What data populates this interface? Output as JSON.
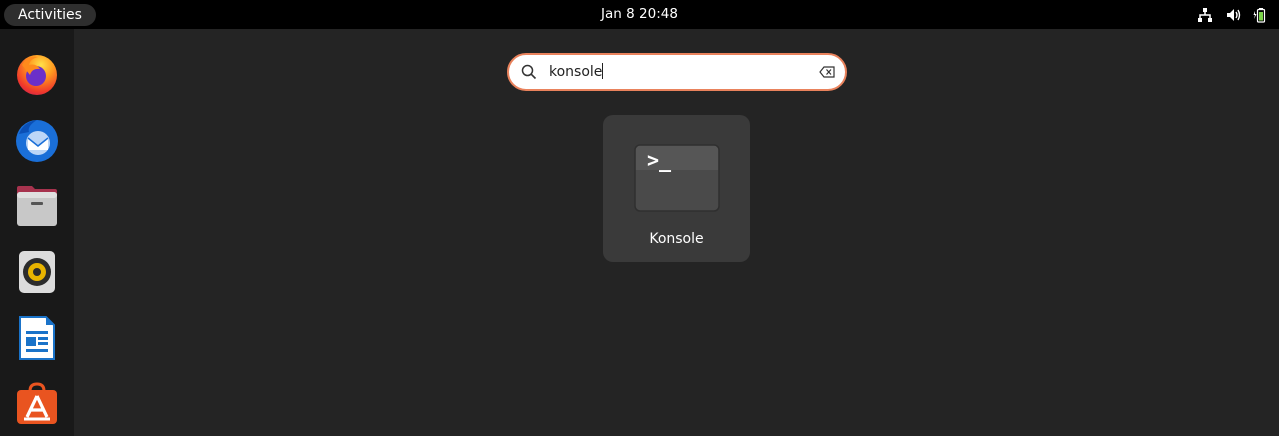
{
  "topbar": {
    "activities_label": "Activities",
    "clock": "Jan 8  20:48",
    "tray_icons": [
      "network-icon",
      "volume-icon",
      "battery-icon"
    ]
  },
  "dock": {
    "items": [
      {
        "name": "Firefox",
        "icon": "firefox-icon"
      },
      {
        "name": "Thunderbird",
        "icon": "thunderbird-icon"
      },
      {
        "name": "Files",
        "icon": "files-icon"
      },
      {
        "name": "Rhythmbox",
        "icon": "rhythmbox-icon"
      },
      {
        "name": "LibreOffice Writer",
        "icon": "libreoffice-writer-icon"
      },
      {
        "name": "Ubuntu Software",
        "icon": "app-center-icon"
      }
    ]
  },
  "search": {
    "value": "konsole",
    "accent": "#e9825c"
  },
  "results": [
    {
      "label": "Konsole",
      "icon": "terminal-icon",
      "prompt": ">_"
    }
  ]
}
